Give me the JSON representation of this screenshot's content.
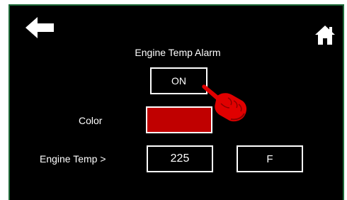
{
  "header": {
    "back_icon": "back-arrow-icon",
    "home_icon": "home-icon",
    "title": "Engine Temp Alarm"
  },
  "alarm": {
    "toggle_label": "ON"
  },
  "color_setting": {
    "label": "Color",
    "value_color": "#c00000"
  },
  "engine_temp": {
    "label": "Engine Temp >",
    "value": "225",
    "unit": "F"
  },
  "colors": {
    "background": "#000000",
    "frame_border": "#1f6b3a",
    "foreground": "#ffffff",
    "pointer": "#e00000"
  },
  "pointer_icon": "pointing-hand-icon"
}
